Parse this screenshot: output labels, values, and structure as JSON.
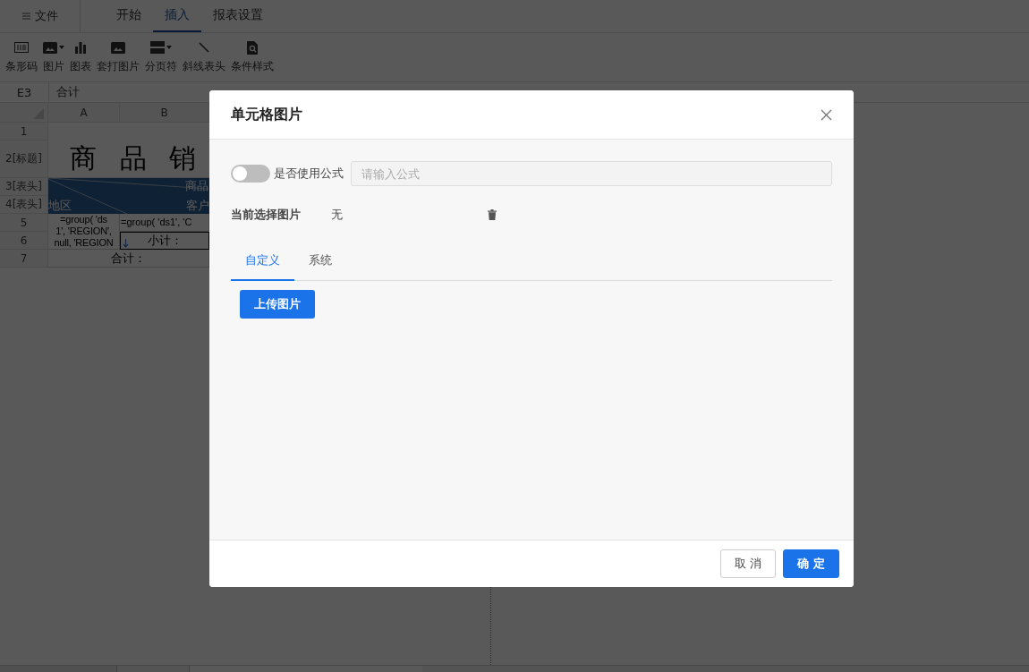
{
  "menu": {
    "label": "文件"
  },
  "tabs": [
    {
      "label": "开始",
      "selected": false
    },
    {
      "label": "插入",
      "selected": true
    },
    {
      "label": "报表设置",
      "selected": false
    }
  ],
  "toolbar": [
    {
      "kind": "barcode",
      "label": "条形码",
      "dropdown": false
    },
    {
      "kind": "image",
      "label": "图片",
      "dropdown": true
    },
    {
      "kind": "chart",
      "label": "图表",
      "dropdown": false
    },
    {
      "kind": "image",
      "label": "套打图片",
      "dropdown": false
    },
    {
      "kind": "pagebreak",
      "label": "分页符",
      "dropdown": true
    },
    {
      "kind": "slash",
      "label": "斜线表头",
      "dropdown": false
    },
    {
      "kind": "condition",
      "label": "条件样式",
      "dropdown": false
    }
  ],
  "formula_bar": {
    "cell": "E3",
    "value": "合计"
  },
  "sheet": {
    "columns": [
      "A",
      "B"
    ],
    "row_headers": [
      "1",
      "2[标题]",
      "3[表头]",
      "4[表头]",
      "5",
      "6",
      "7"
    ],
    "title": "商 品 销",
    "diagonal_header": {
      "top_right": "商品",
      "left": "地区",
      "bottom_right": "客户"
    },
    "a5": [
      "=group( 'ds",
      "1', 'REGION',",
      "null, 'REGION"
    ],
    "b5": "=group( 'ds1', 'C",
    "b6": "小计：",
    "total": "合计："
  },
  "dialog": {
    "title": "单元格图片",
    "formula_toggle": {
      "label": "是否使用公式",
      "on": false
    },
    "formula_input": {
      "placeholder": "请输入公式"
    },
    "current_label": "当前选择图片",
    "current_value": "无",
    "tabs": [
      {
        "label": "自定义",
        "selected": true
      },
      {
        "label": "系统",
        "selected": false
      }
    ],
    "upload_button": "上传图片",
    "buttons": [
      {
        "label": "取 消",
        "kind": "secondary"
      },
      {
        "label": "确 定",
        "kind": "primary"
      }
    ]
  }
}
